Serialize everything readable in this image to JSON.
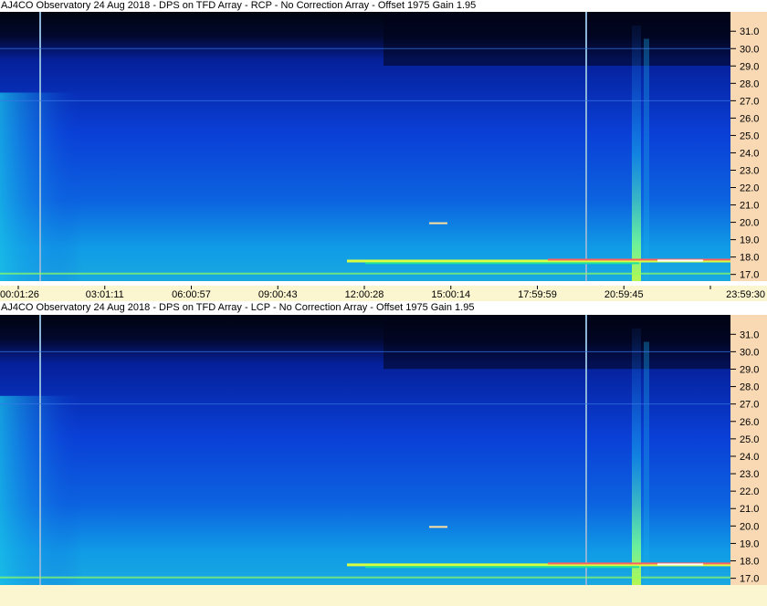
{
  "panels": [
    {
      "title": "AJ4CO Observatory 24 Aug 2018 - DPS on TFD Array  - RCP  -  No Correction Array  -  Offset 1975  Gain 1.95",
      "polarization": "RCP"
    },
    {
      "title": "AJ4CO Observatory 24 Aug 2018 - DPS on TFD Array  - LCP  -  No Correction Array  -  Offset 1975  Gain 1.95",
      "polarization": "LCP"
    }
  ],
  "chart_data": {
    "type": "heatmap",
    "x_ticks": [
      "00:01:26",
      "03:01:11",
      "06:00:57",
      "09:00:43",
      "12:00:28",
      "15:00:14",
      "17:59:59",
      "20:59:45",
      "23:59:30"
    ],
    "y_ticks": [
      "31.0",
      "30.0",
      "29.0",
      "28.0",
      "27.0",
      "26.0",
      "25.0",
      "24.0",
      "23.0",
      "22.0",
      "21.0",
      "20.0",
      "19.0",
      "18.0",
      "17.0"
    ],
    "ylim": [
      16.3,
      31.8
    ],
    "colors": {
      "low": "#000814",
      "mid": "#0a3cd8",
      "high": "#18c8e8",
      "peak": "#e8ff30",
      "axis_bg": "#f8d9b4",
      "time_bg": "#fbf6cf"
    }
  }
}
